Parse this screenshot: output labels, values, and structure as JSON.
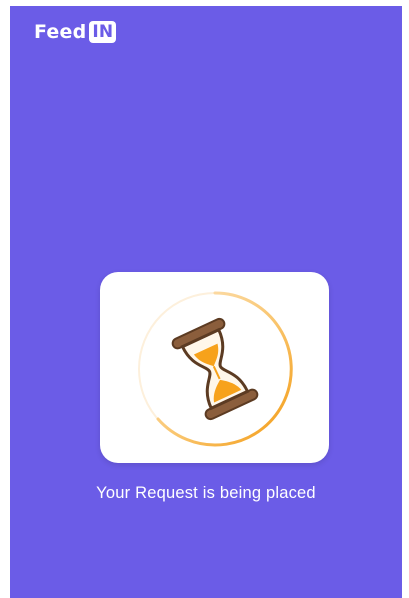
{
  "app": {
    "logo_text": "Feed",
    "logo_badge": "IN"
  },
  "loader": {
    "icon": "hourglass-icon",
    "spinner": "progress-ring"
  },
  "status": {
    "message": "Your Request is being placed"
  },
  "colors": {
    "background": "#6b5ce7",
    "card": "#ffffff",
    "accent": "#f7a21b",
    "hourglass_frame": "#8b5e3c"
  }
}
